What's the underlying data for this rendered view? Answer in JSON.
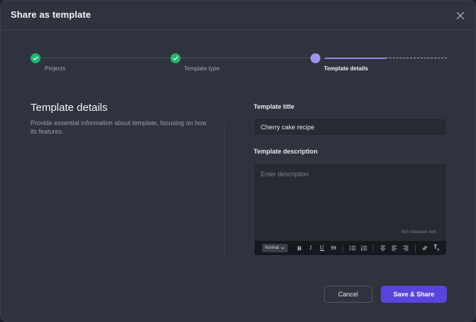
{
  "dialog": {
    "title": "Share as template"
  },
  "stepper": {
    "steps": [
      {
        "label": "Projects",
        "state": "done"
      },
      {
        "label": "Template type",
        "state": "done"
      },
      {
        "label": "Template details",
        "state": "active"
      }
    ]
  },
  "section": {
    "heading": "Template details",
    "description": "Provide essential information about template, focusing on how its features."
  },
  "form": {
    "title_label": "Template title",
    "title_value": "Cherry cake recipe",
    "description_label": "Template description",
    "description_placeholder": "Enter description",
    "char_limit": "500 character limit"
  },
  "toolbar": {
    "format_select": "Normal",
    "bold": "B",
    "italic": "I",
    "underline": "U",
    "quote": "99",
    "clear_format": "T"
  },
  "footer": {
    "cancel_label": "Cancel",
    "primary_label": "Save & Share"
  },
  "colors": {
    "accent": "#5a45dc",
    "success": "#22b573",
    "active_step": "#9c93f0"
  }
}
